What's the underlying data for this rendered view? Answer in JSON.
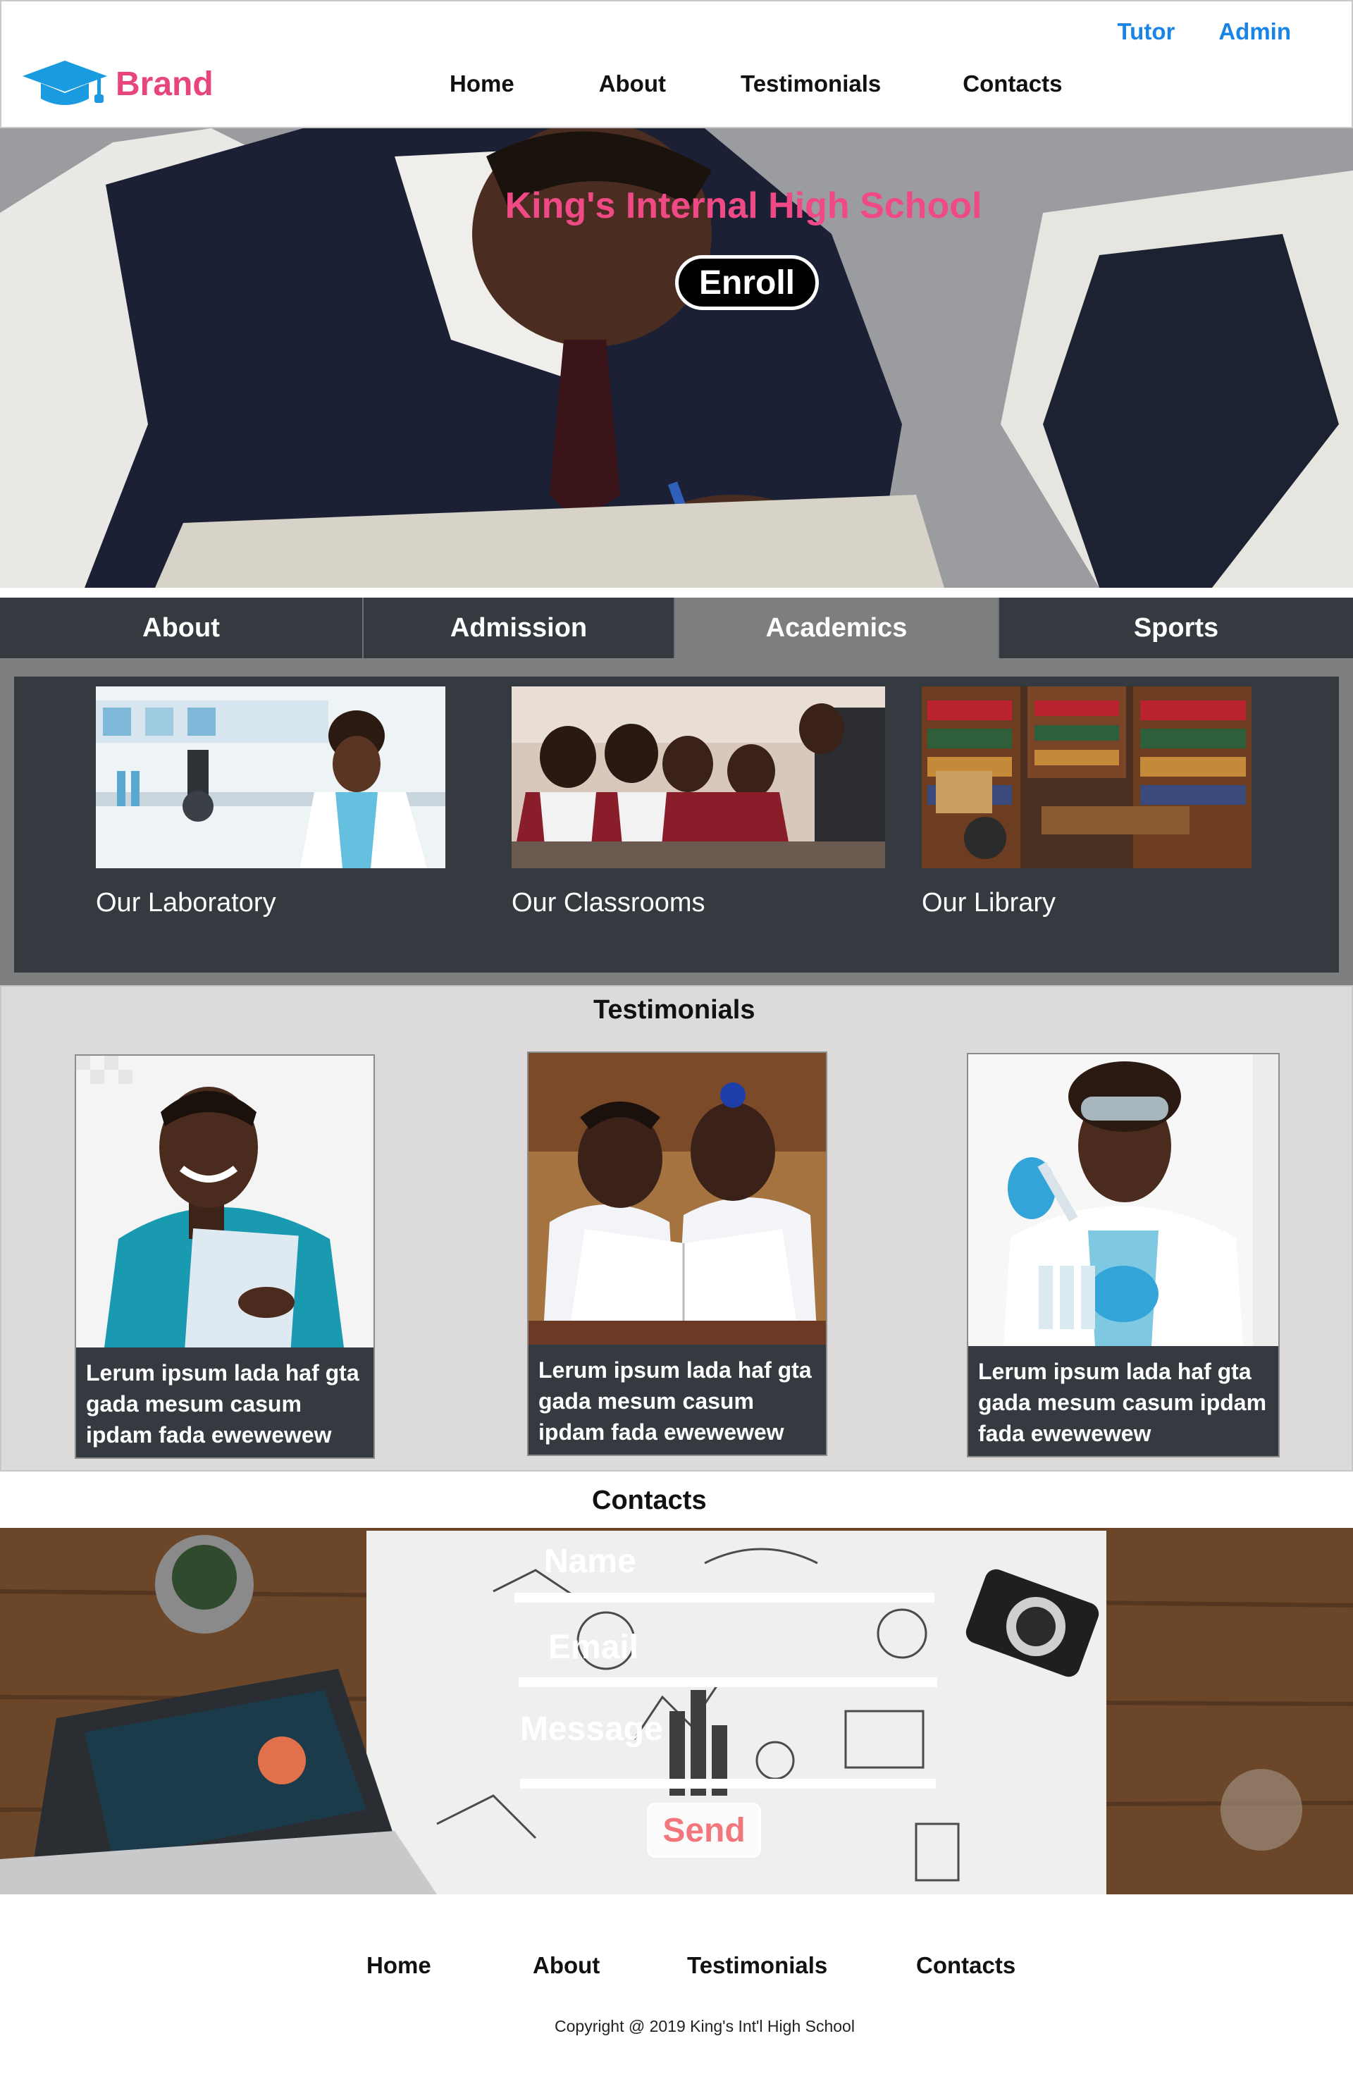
{
  "header": {
    "brand": "Brand",
    "brand_icon": "graduation-cap-icon",
    "top_links": [
      "Tutor",
      "Admin"
    ],
    "nav": [
      "Home",
      "About",
      "Testimonials",
      "Contacts"
    ]
  },
  "hero": {
    "title": "King's Internal High School",
    "enroll_label": "Enroll"
  },
  "tabs": {
    "items": [
      "About",
      "Admission",
      "Academics",
      "Sports"
    ],
    "active": "Academics"
  },
  "facilities": [
    {
      "caption": "Our Laboratory"
    },
    {
      "caption": "Our Classrooms"
    },
    {
      "caption": "Our Library"
    }
  ],
  "testimonials": {
    "title": "Testimonials",
    "items": [
      {
        "text": "Lerum ipsum lada haf gta gada mesum casum ipdam fada ewewewew"
      },
      {
        "text": "Lerum ipsum lada haf gta gada mesum casum ipdam fada ewewewew"
      },
      {
        "text": "Lerum ipsum lada haf gta gada mesum casum ipdam fada ewewewew"
      }
    ]
  },
  "contacts": {
    "title": "Contacts",
    "name_label": "Name",
    "email_label": "Email",
    "message_label": "Message",
    "send_label": "Send"
  },
  "footer": {
    "nav": [
      "Home",
      "About",
      "Testimonials",
      "Contacts"
    ],
    "copyright": "Copyright @ 2019 King's Int'l High School"
  },
  "colors": {
    "brand_pink": "#e8457c",
    "link_blue": "#1a84e6",
    "dark_panel": "#353a41",
    "active_tab": "#7d7e80",
    "testimonial_bg": "#dcdadb"
  }
}
